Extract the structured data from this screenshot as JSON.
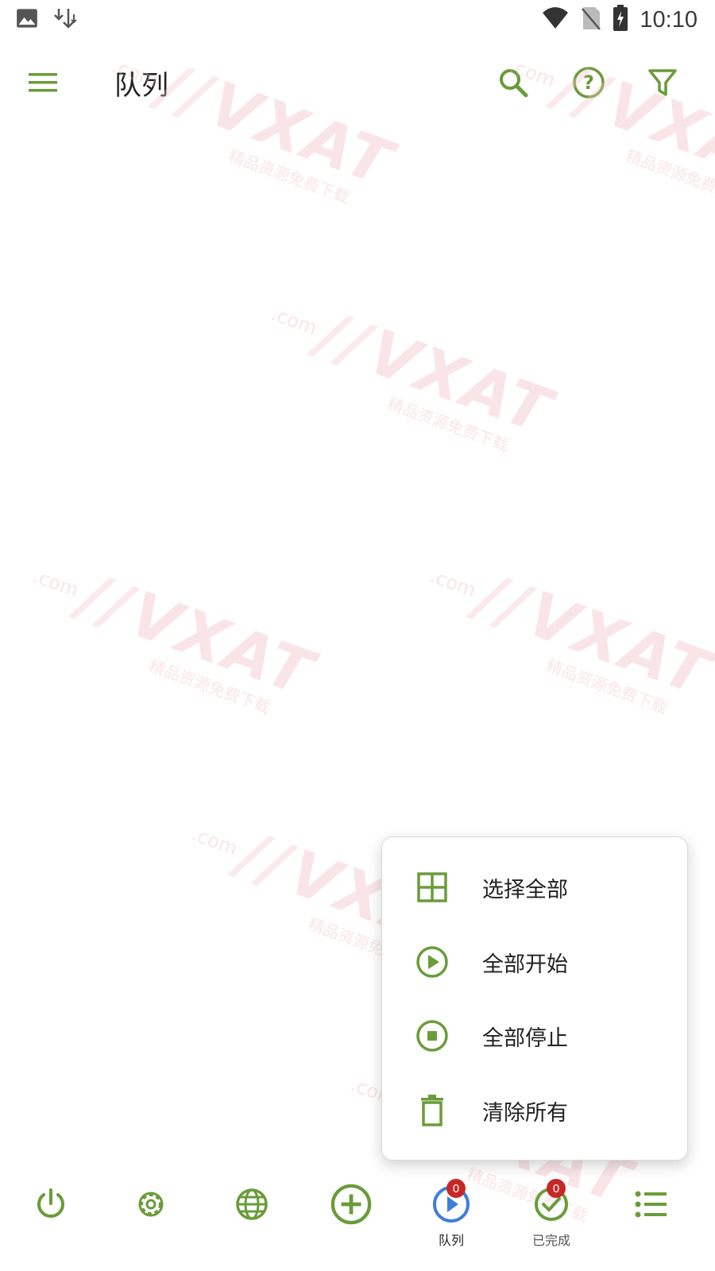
{
  "colors": {
    "accent": "#6a9c3a",
    "active": "#3f7fd8",
    "badge": "#c62828"
  },
  "status_bar": {
    "time": "10:10",
    "left_icons": [
      "image-icon",
      "download-icon"
    ],
    "right_icons": [
      "wifi-icon",
      "no-sim-icon",
      "battery-charging-icon"
    ]
  },
  "app_bar": {
    "title": "队列",
    "actions": [
      "search-icon",
      "help-icon",
      "filter-icon"
    ]
  },
  "watermark": {
    "brand": "VXAT",
    "domain": ".com",
    "tagline": "精品资源免费下载"
  },
  "popup_menu": {
    "items": [
      {
        "label": "选择全部",
        "icon": "grid-icon"
      },
      {
        "label": "全部开始",
        "icon": "play-circle-icon"
      },
      {
        "label": "全部停止",
        "icon": "stop-circle-icon"
      },
      {
        "label": "清除所有",
        "icon": "trash-icon"
      }
    ]
  },
  "bottom_nav": {
    "items": [
      {
        "icon": "power-icon"
      },
      {
        "icon": "gear-icon"
      },
      {
        "icon": "globe-icon"
      },
      {
        "icon": "add-circle-icon"
      },
      {
        "icon": "play-circle-icon",
        "label": "队列",
        "badge": "0",
        "active": true
      },
      {
        "icon": "check-circle-icon",
        "label": "已完成",
        "badge": "0"
      },
      {
        "icon": "list-icon"
      }
    ]
  }
}
